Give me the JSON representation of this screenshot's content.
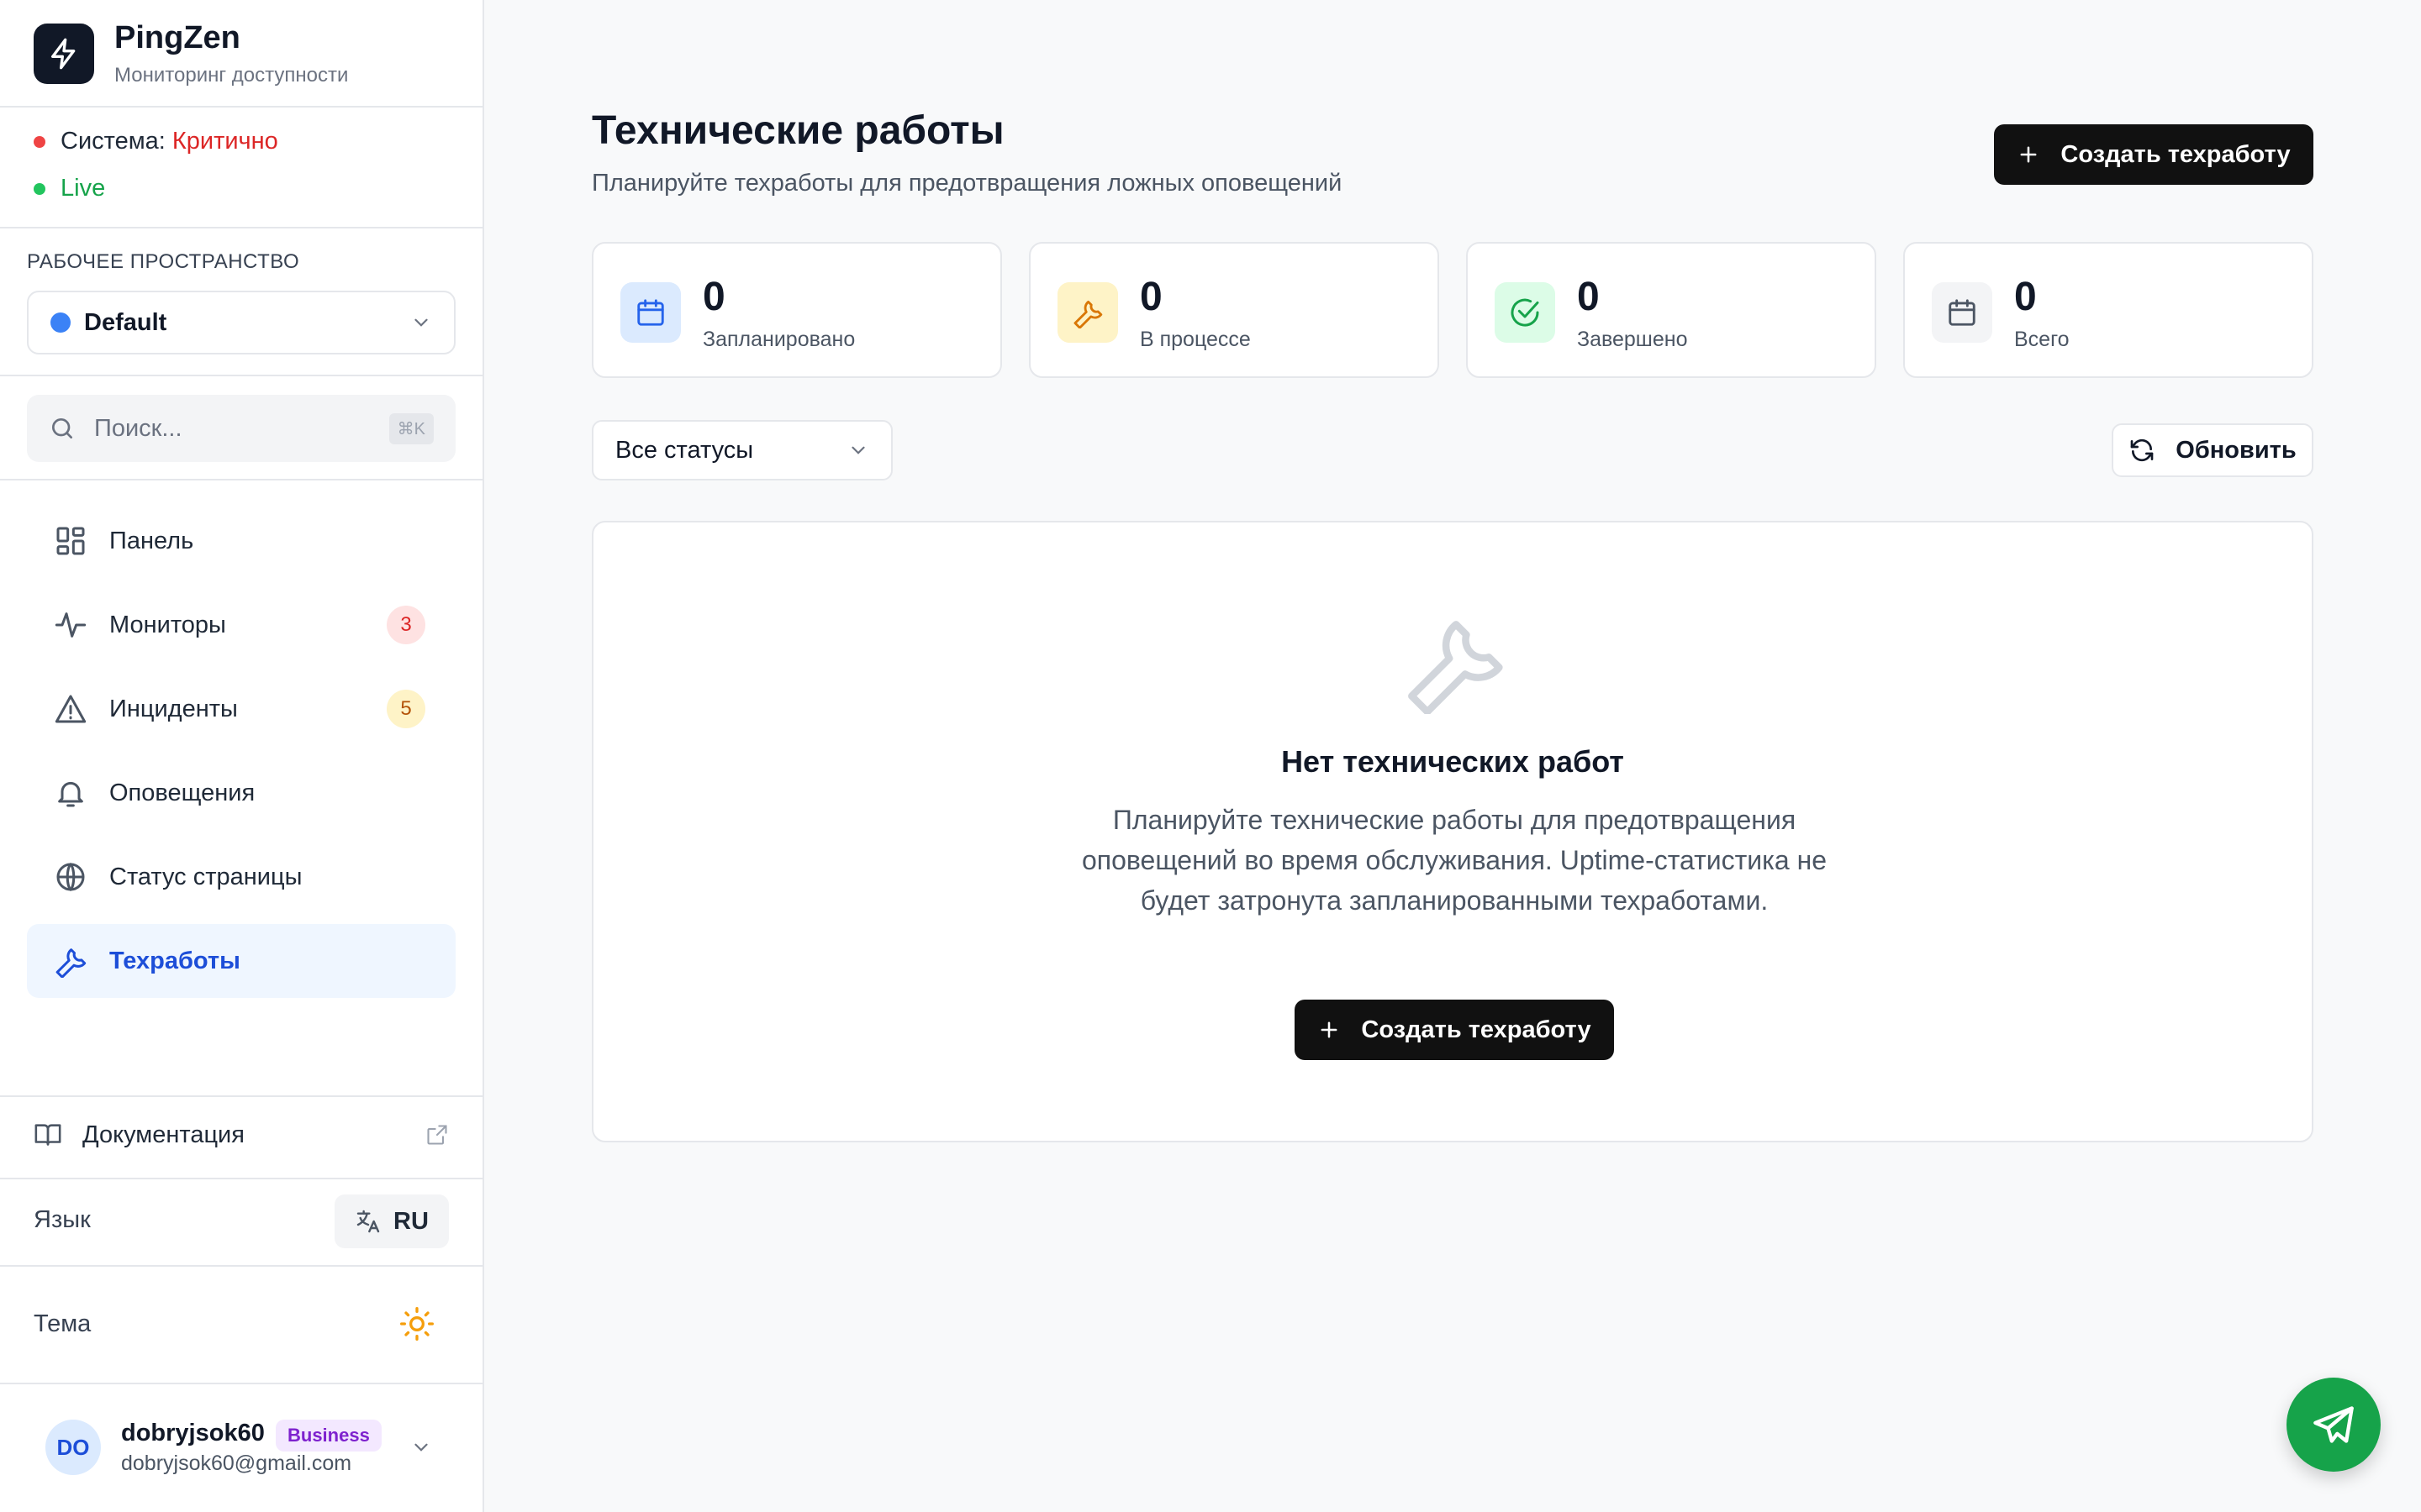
{
  "brand": {
    "name": "PingZen",
    "subtitle": "Мониторинг доступности"
  },
  "system": {
    "label": "Система:",
    "value": "Критично",
    "live": "Live"
  },
  "workspace": {
    "title": "РАБОЧЕЕ ПРОСТРАНСТВО",
    "selected": "Default",
    "color": "#3b82f6"
  },
  "search": {
    "placeholder": "Поиск...",
    "shortcut": "⌘K"
  },
  "nav": [
    {
      "label": "Панель",
      "icon": "dashboard-icon"
    },
    {
      "label": "Мониторы",
      "icon": "activity-icon",
      "badge": "3"
    },
    {
      "label": "Инциденты",
      "icon": "alert-triangle-icon",
      "badge": "5"
    },
    {
      "label": "Оповещения",
      "icon": "bell-icon"
    },
    {
      "label": "Статус страницы",
      "icon": "globe-icon"
    },
    {
      "label": "Техработы",
      "icon": "wrench-icon",
      "active": true
    }
  ],
  "docs": {
    "label": "Документация"
  },
  "language": {
    "label": "Язык",
    "value": "RU"
  },
  "theme": {
    "label": "Тема"
  },
  "user": {
    "initials": "DO",
    "name": "dobryjsok60",
    "plan": "Business",
    "email": "dobryjsok60@gmail.com"
  },
  "page": {
    "title": "Технические работы",
    "subtitle": "Планируйте техработы для предотвращения ложных оповещений",
    "create_label": "Создать техработу"
  },
  "stats": [
    {
      "value": "0",
      "label": "Запланировано",
      "icon": "calendar-icon",
      "color": "#2563eb"
    },
    {
      "value": "0",
      "label": "В процессе",
      "icon": "wrench-icon",
      "color": "#d97706"
    },
    {
      "value": "0",
      "label": "Завершено",
      "icon": "check-circle-icon",
      "color": "#16a34a"
    },
    {
      "value": "0",
      "label": "Всего",
      "icon": "calendar-icon",
      "color": "#4b5563"
    }
  ],
  "filter": {
    "value": "Все статусы"
  },
  "refresh_label": "Обновить",
  "empty": {
    "title": "Нет технических работ",
    "text": "Планируйте технические работы для предотвращения оповещений во время обслуживания. Uptime-статистика не будет затронута запланированными техработами.",
    "button": "Создать техработу"
  },
  "colors": {
    "accent": "#1d4ed8",
    "dark_button": "#111111",
    "critical": "#dc2626",
    "live": "#16a34a",
    "fab": "#16a34a"
  }
}
